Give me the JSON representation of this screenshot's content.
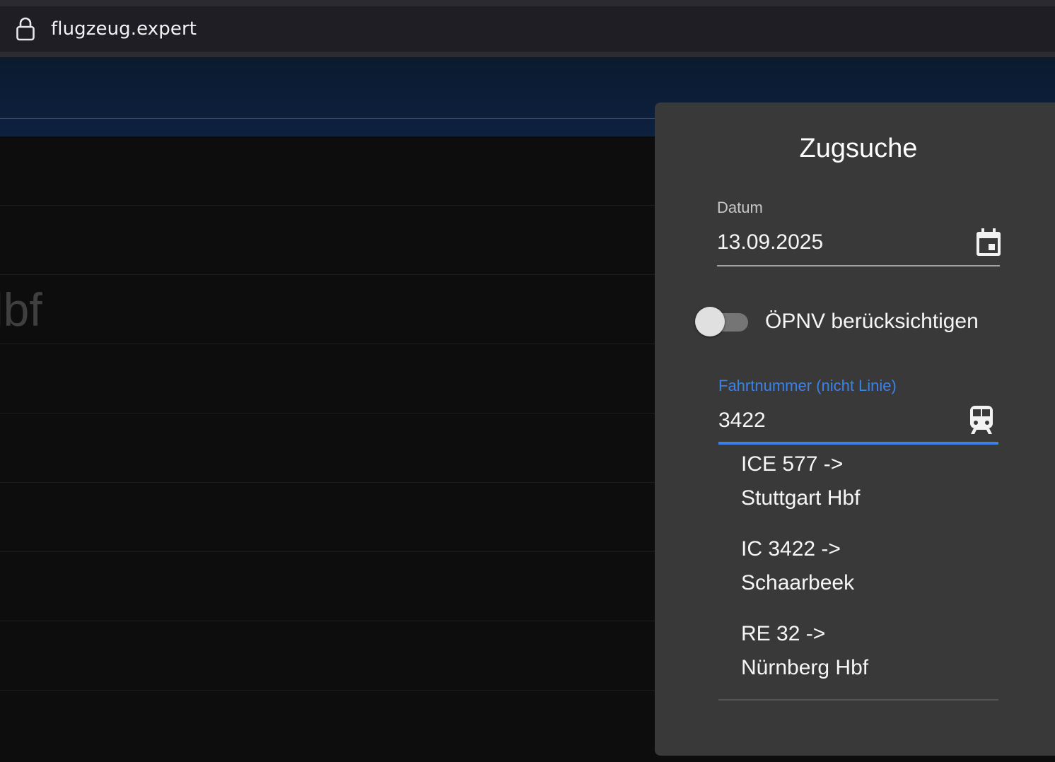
{
  "browser": {
    "url": "flugzeug.expert"
  },
  "background": {
    "station_fragment": "lbf"
  },
  "panel": {
    "title": "Zugsuche",
    "date": {
      "label": "Datum",
      "value": "13.09.2025",
      "icon": "calendar-icon"
    },
    "opnv_toggle": {
      "label": "ÖPNV berücksichtigen",
      "checked": false
    },
    "train_number": {
      "label": "Fahrtnummer (nicht Linie)",
      "value": "3422",
      "icon": "train-icon"
    },
    "suggestions": [
      {
        "line1": "ICE 577 ->",
        "line2": "Stuttgart Hbf"
      },
      {
        "line1": "IC 3422 ->",
        "line2": "Schaarbeek"
      },
      {
        "line1": "RE 32 ->",
        "line2": "Nürnberg Hbf"
      }
    ]
  },
  "colors": {
    "accent": "#3a82e6",
    "panel_bg": "#393939",
    "header_bg": "#0d2140"
  }
}
